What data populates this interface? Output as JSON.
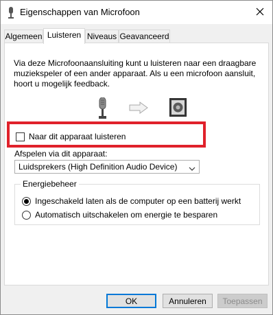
{
  "window": {
    "title": "Eigenschappen van Microfoon",
    "icon": "microphone-icon",
    "close_icon": "close-icon"
  },
  "tabs": [
    {
      "label": "Algemeen",
      "active": false
    },
    {
      "label": "Luisteren",
      "active": true
    },
    {
      "label": "Niveaus",
      "active": false
    },
    {
      "label": "Geavanceerd",
      "active": false
    }
  ],
  "panel": {
    "description": "Via deze Microfoonaansluiting kunt u luisteren naar een draagbare muziekspeler of een ander apparaat. Als u een microfoon aansluit, hoort u mogelijk feedback.",
    "illustration": {
      "mic_icon": "microphone-icon",
      "arrow_icon": "arrow-right-icon",
      "speaker_icon": "speaker-icon"
    },
    "listen_checkbox": {
      "label": "Naar dit apparaat luisteren",
      "checked": false
    },
    "playback": {
      "label": "Afspelen via dit apparaat:",
      "selected": "Luidsprekers (High Definition Audio Device)"
    },
    "power": {
      "legend": "Energiebeheer",
      "options": [
        {
          "label": "Ingeschakeld laten als de computer op een batterij werkt",
          "checked": true
        },
        {
          "label": "Automatisch uitschakelen om energie te besparen",
          "checked": false
        }
      ]
    }
  },
  "buttons": {
    "ok": "OK",
    "cancel": "Annuleren",
    "apply": "Toepassen"
  },
  "colors": {
    "highlight": "#e0212b",
    "default_button_border": "#0078d7"
  }
}
